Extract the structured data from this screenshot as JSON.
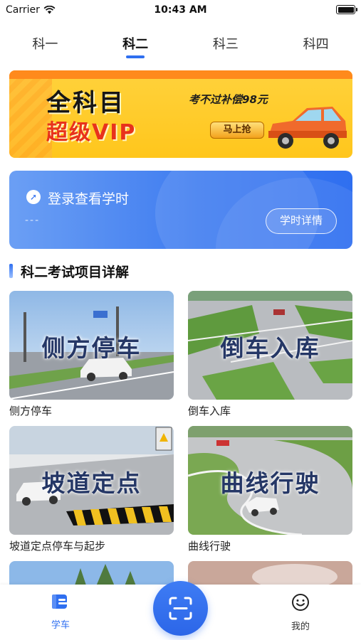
{
  "status_bar": {
    "carrier": "Carrier",
    "time": "10:43 AM"
  },
  "tabs": [
    {
      "label": "科一",
      "active": false
    },
    {
      "label": "科二",
      "active": true
    },
    {
      "label": "科三",
      "active": false
    },
    {
      "label": "科四",
      "active": false
    }
  ],
  "banner": {
    "line1": "全科目",
    "line2": "超级VIP",
    "promo": "考不过补偿98元",
    "button": "马上抢"
  },
  "login_card": {
    "title": "登录查看学时",
    "subtitle": "---",
    "button": "学时详情"
  },
  "section": {
    "title": "科二考试项目详解"
  },
  "items": [
    {
      "thumb_title": "侧方停车",
      "label": "侧方停车"
    },
    {
      "thumb_title": "倒车入库",
      "label": "倒车入库"
    },
    {
      "thumb_title": "坡道定点",
      "label": "坡道定点停车与起步"
    },
    {
      "thumb_title": "曲线行驶",
      "label": "曲线行驶"
    }
  ],
  "bottom_nav": {
    "learn_label": "学车",
    "mine_label": "我的"
  },
  "colors": {
    "accent": "#2f6ff0",
    "banner_yellow": "#ffc61c",
    "banner_red": "#e8321c"
  }
}
